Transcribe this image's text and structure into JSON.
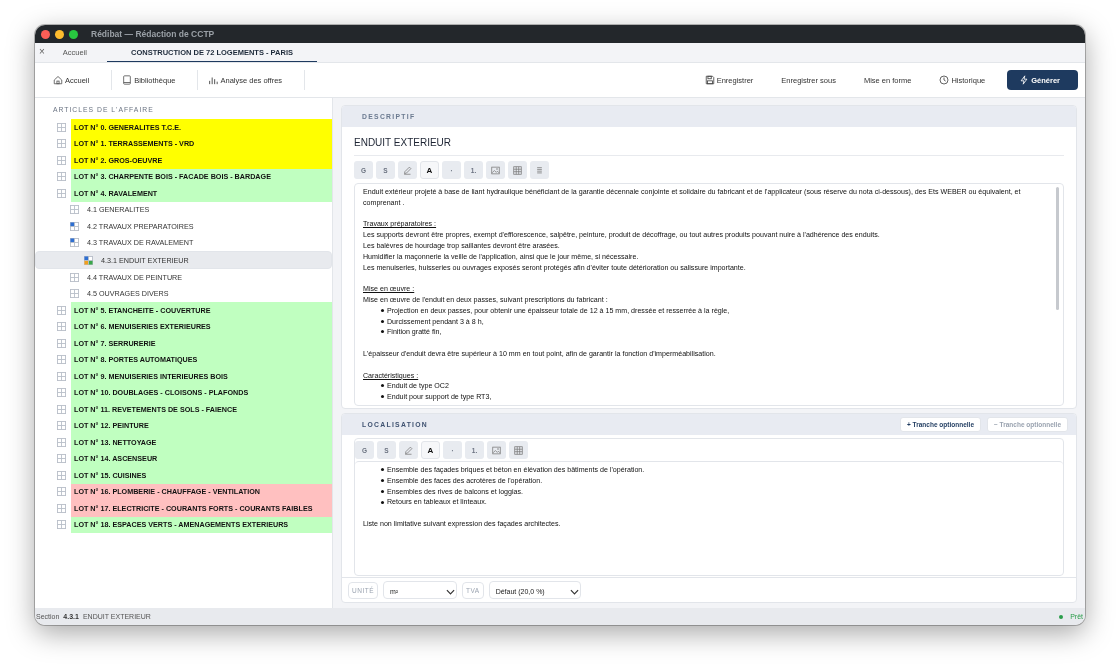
{
  "window": {
    "title": "Rédibat — Rédaction de CCTP"
  },
  "tabs": [
    {
      "label": "Accueil",
      "selected": false,
      "close": "×"
    },
    {
      "label": "CONSTRUCTION DE 72 LOGEMENTS - PARIS",
      "selected": true
    }
  ],
  "toolbar": {
    "left": [
      {
        "label": "Accueil"
      },
      {
        "label": "Bibliothèque"
      },
      {
        "label": "Analyse des offres"
      }
    ],
    "right": [
      {
        "label": "Enregistrer",
        "primary": false
      },
      {
        "label": "Enregistrer sous",
        "primary": false
      },
      {
        "label": "Mise en forme",
        "primary": false
      },
      {
        "label": "Historique",
        "primary": false
      },
      {
        "label": "Générer",
        "primary": true
      }
    ]
  },
  "sidebar": {
    "heading": "ARTICLES DE L'AFFAIRE",
    "tree": [
      {
        "label": "LOT N° 0. GENERALITES T.C.E.",
        "kind": "plain",
        "color": "#ffff00",
        "selected": false
      },
      {
        "label": "LOT N° 1. TERRASSEMENTS - VRD",
        "kind": "plain",
        "color": "#ffff00",
        "selected": false
      },
      {
        "label": "LOT N° 2. GROS-OEUVRE",
        "kind": "plain",
        "color": "#ffff00",
        "selected": false
      },
      {
        "label": "LOT N° 3. CHARPENTE BOIS - FACADE BOIS - BARDAGE",
        "kind": "plain",
        "color": "#c0ffc0",
        "selected": false
      },
      {
        "label": "LOT N° 4. RAVALEMENT",
        "kind": "plain",
        "color": "#c0ffc0",
        "selected": false,
        "children": [
          {
            "label": "4.1 GENERALITES",
            "kind": "plain",
            "selected": false
          },
          {
            "label": "4.2 TRAVAUX PREPARATOIRES",
            "kind": "partial",
            "selected": false
          },
          {
            "label": "4.3 TRAVAUX DE RAVALEMENT",
            "kind": "partial",
            "selected": false,
            "children": [
              {
                "label": "4.3.1 ENDUIT EXTERIEUR",
                "kind": "mixed",
                "selected": true
              }
            ]
          },
          {
            "label": "4.4 TRAVAUX DE PEINTURE",
            "kind": "plain",
            "selected": false
          },
          {
            "label": "4.5 OUVRAGES DIVERS",
            "kind": "plain",
            "selected": false
          }
        ]
      },
      {
        "label": "LOT N° 5. ETANCHEITE - COUVERTURE",
        "kind": "plain",
        "color": "#c0ffc0",
        "selected": false
      },
      {
        "label": "LOT N° 6. MENUISERIES EXTERIEURES",
        "kind": "plain",
        "color": "#c0ffc0",
        "selected": false
      },
      {
        "label": "LOT N° 7. SERRURERIE",
        "kind": "plain",
        "color": "#c0ffc0",
        "selected": false
      },
      {
        "label": "LOT N° 8. PORTES AUTOMATIQUES",
        "kind": "plain",
        "color": "#c0ffc0",
        "selected": false
      },
      {
        "label": "LOT N° 9. MENUISERIES INTERIEURES BOIS",
        "kind": "plain",
        "color": "#c0ffc0",
        "selected": false
      },
      {
        "label": "LOT N° 10. DOUBLAGES - CLOISONS - PLAFONDS",
        "kind": "plain",
        "color": "#c0ffc0",
        "selected": false
      },
      {
        "label": "LOT N° 11. REVETEMENTS DE SOLS - FAIENCE",
        "kind": "plain",
        "color": "#c0ffc0",
        "selected": false
      },
      {
        "label": "LOT N° 12. PEINTURE",
        "kind": "plain",
        "color": "#c0ffc0",
        "selected": false
      },
      {
        "label": "LOT N° 13. NETTOYAGE",
        "kind": "plain",
        "color": "#c0ffc0",
        "selected": false
      },
      {
        "label": "LOT N° 14. ASCENSEUR",
        "kind": "plain",
        "color": "#c0ffc0",
        "selected": false
      },
      {
        "label": "LOT N° 15. CUISINES",
        "kind": "plain",
        "color": "#c0ffc0",
        "selected": false
      },
      {
        "label": "LOT N° 16. PLOMBERIE - CHAUFFAGE - VENTILATION",
        "kind": "plain",
        "color": "#ffc0c0",
        "selected": false
      },
      {
        "label": "LOT N° 17. ELECTRICITE - COURANTS FORTS - COURANTS FAIBLES",
        "kind": "plain",
        "color": "#ffc0c0",
        "selected": false
      },
      {
        "label": "LOT N° 18. ESPACES VERTS - AMENAGEMENTS EXTERIEURS",
        "kind": "plain",
        "color": "#c0ffc0",
        "selected": false
      }
    ]
  },
  "descriptif": {
    "header": "DESCRIPTIF",
    "title": "ENDUIT EXTERIEUR",
    "toolbar": [
      {
        "kind": "text",
        "label": "G",
        "active": false
      },
      {
        "kind": "text",
        "label": "S",
        "active": false
      },
      {
        "kind": "pen",
        "active": false
      },
      {
        "kind": "text",
        "label": "A",
        "active": true
      },
      {
        "kind": "text",
        "label": "·",
        "active": false
      },
      {
        "kind": "text",
        "label": "1.",
        "active": false
      },
      {
        "kind": "image",
        "active": false
      },
      {
        "kind": "table",
        "active": false
      },
      {
        "kind": "list",
        "active": false
      }
    ],
    "content": [
      [
        {
          "kind": "line",
          "text": "Enduit extérieur projeté à base de liant hydraulique bénéficiant de la garantie décennale conjointe et solidaire du fabricant et de l'applicateur (sous réserve du nota ci-dessous), des Ets WEBER ou équivalent, et comprenant ."
        }
      ],
      [
        {
          "kind": "heading",
          "text": "Travaux préparatoires :"
        },
        {
          "kind": "line",
          "text": "Les supports devront être propres, exempt d'efflorescence, salpêtre, peinture, produit de décoffrage, ou tout autres produits pouvant nuire à l'adhérence des enduits."
        },
        {
          "kind": "line",
          "text": "Les balèvres de hourdage trop saillantes devront être arasées."
        },
        {
          "kind": "line",
          "text": "Humidifier la maçonnerie la veille de l'application, ainsi que le jour même, si nécessaire."
        },
        {
          "kind": "line",
          "text": "Les menuiseries, huisseries ou ouvrages exposés seront protégés afin d'éviter toute détérioration ou salissure importante."
        }
      ],
      [
        {
          "kind": "heading",
          "text": "Mise en œuvre :"
        },
        {
          "kind": "line",
          "text": "Mise en œuvre de l'enduit en deux passes, suivant prescriptions du fabricant :"
        },
        {
          "kind": "bullet",
          "text": "Projection en deux passes, pour obtenir une épaisseur totale de 12 à 15 mm, dressée et resserrée à la règle,"
        },
        {
          "kind": "bullet",
          "text": "Durcissement pendant 3 à 8 h,"
        },
        {
          "kind": "bullet",
          "text": "Finition gratté fin,"
        }
      ],
      [
        {
          "kind": "line",
          "text": "L'épaisseur d'enduit devra être supérieur à 10 mm en tout point, afin de garantir la fonction d'imperméabilisation."
        }
      ],
      [
        {
          "kind": "heading",
          "text": "Caractéristiques :"
        },
        {
          "kind": "bullet",
          "text": "Enduit de type OC2"
        },
        {
          "kind": "bullet",
          "text": "Enduit pour support de type RT3,"
        }
      ]
    ]
  },
  "localisation": {
    "header": "LOCALISATION",
    "actions": [
      {
        "label": "+ Tranche optionnelle",
        "disabled": false
      },
      {
        "label": "− Tranche optionnelle",
        "disabled": true
      }
    ],
    "toolbar": [
      {
        "kind": "text",
        "label": "G",
        "active": false
      },
      {
        "kind": "text",
        "label": "S",
        "active": false
      },
      {
        "kind": "pen",
        "active": false
      },
      {
        "kind": "text",
        "label": "A",
        "active": true
      },
      {
        "kind": "text",
        "label": "·",
        "active": false
      },
      {
        "kind": "text",
        "label": "1.",
        "active": false
      },
      {
        "kind": "image",
        "active": false
      },
      {
        "kind": "table",
        "active": false
      }
    ],
    "content": [
      [
        {
          "kind": "bullet",
          "text": "Ensemble des façades briques et béton en élévation des bâtiments de l'opération."
        },
        {
          "kind": "bullet",
          "text": "Ensemble des faces des acrotères de l'opération."
        },
        {
          "kind": "bullet",
          "text": "Ensembles des rives de balcons et loggias."
        },
        {
          "kind": "bullet",
          "text": "Retours en tableaux et linteaux."
        }
      ],
      [
        {
          "kind": "line",
          "text": "Liste non limitative suivant expression des façades architectes."
        }
      ]
    ],
    "unit_label": "UNITÉ",
    "unit": "m²",
    "tva_label": "TVA",
    "tva": "Défaut (20,0 %)"
  },
  "status_bar": {
    "prefix": "Section",
    "number": "4.3.1",
    "title": "ENDUIT EXTERIEUR",
    "state": "Prêt"
  }
}
